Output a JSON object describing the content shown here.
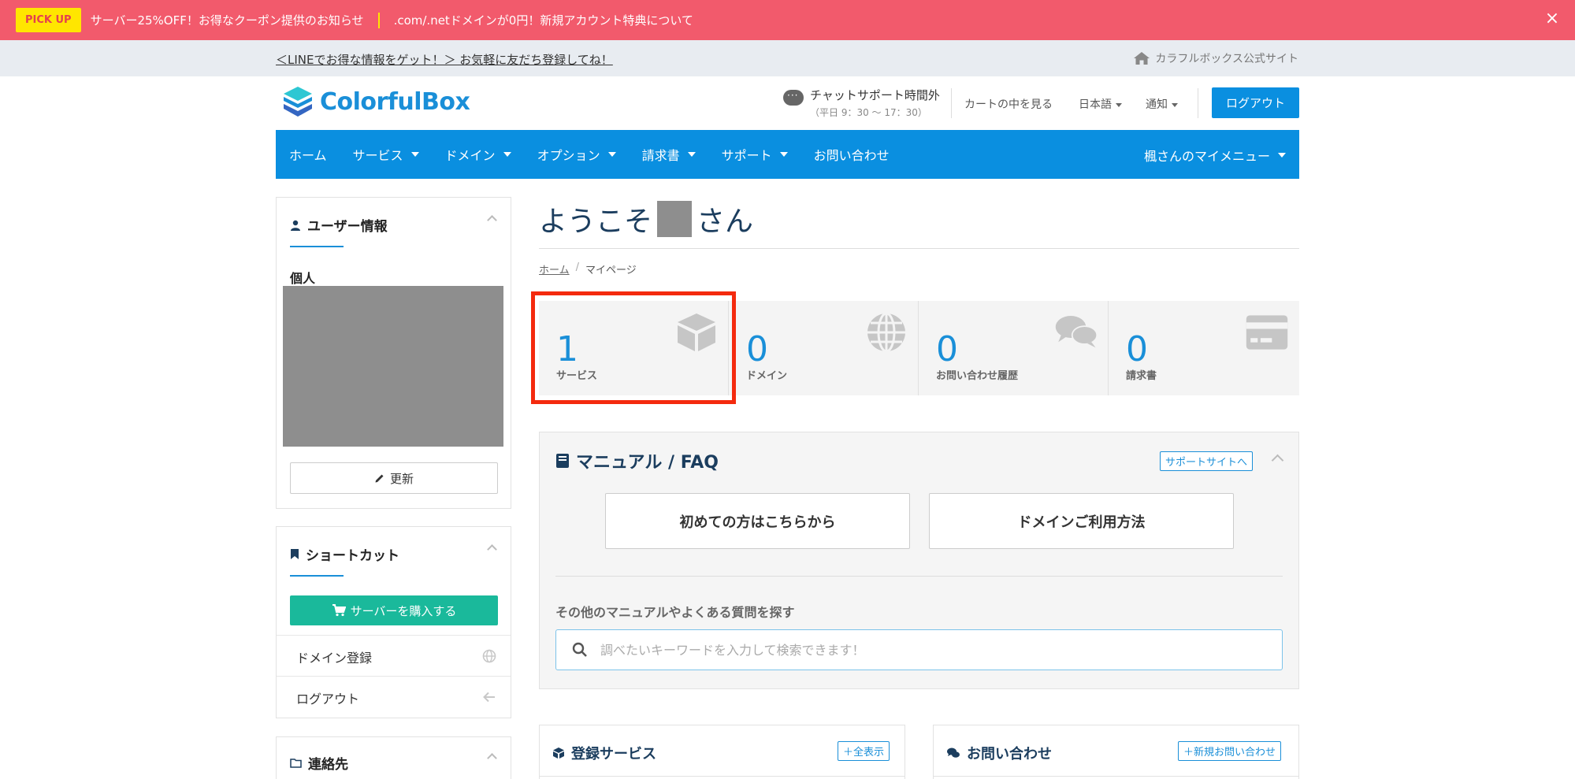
{
  "pickup": {
    "badge": "PICK UP",
    "notice1": "サーバー25%OFF！お得なクーポン提供のお知らせ",
    "notice2": ".com/.netドメインが0円！新規アカウント特典について",
    "close": "×"
  },
  "line_bar": {
    "line_text": "＜LINEでお得な情報をゲット！＞ お気軽に友だち登録してね！",
    "official_site": "カラフルボックス公式サイト"
  },
  "header": {
    "logo_text": "ColorfulBox",
    "chat_title": "チャットサポート時間外",
    "chat_hours": "（平日 9：30 〜 17：30）",
    "cart": "カートの中を見る",
    "language": "日本語",
    "notice": "通知",
    "logout": "ログアウト"
  },
  "nav": {
    "items": [
      {
        "label": "ホーム"
      },
      {
        "label": "サービス"
      },
      {
        "label": "ドメイン"
      },
      {
        "label": "オプション"
      },
      {
        "label": "請求書"
      },
      {
        "label": "サポート"
      },
      {
        "label": "お問い合わせ"
      }
    ],
    "my_menu": "楓さんのマイメニュー"
  },
  "sidebar": {
    "user_info_title": "ユーザー情報",
    "personal": "個人",
    "update": "更新",
    "shortcut_title": "ショートカット",
    "buy_server": "サーバーを購入する",
    "domain_register": "ドメイン登録",
    "logout": "ログアウト",
    "contact_title": "連絡先"
  },
  "main": {
    "welcome_prefix": "ようこそ",
    "welcome_suffix": "さん",
    "breadcrumb_home": "ホーム",
    "breadcrumb_sep": "/",
    "breadcrumb_current": "マイページ",
    "stats": [
      {
        "number": "1",
        "label": "サービス",
        "icon": "box-icon"
      },
      {
        "number": "0",
        "label": "ドメイン",
        "icon": "globe-icon"
      },
      {
        "number": "0",
        "label": "お問い合わせ履歴",
        "icon": "comments-icon"
      },
      {
        "number": "0",
        "label": "請求書",
        "icon": "credit-card-icon"
      }
    ],
    "faq": {
      "title": "マニュアル / FAQ",
      "support_site": "サポートサイトへ",
      "btn_first": "初めての方はこちらから",
      "btn_domain": "ドメインご利用方法",
      "search_label": "その他のマニュアルやよくある質問を探す",
      "search_placeholder": "調べたいキーワードを入力して検索できます！"
    },
    "services_panel": {
      "title": "登録サービス",
      "link": "全表示"
    },
    "contact_panel": {
      "title": "お問い合わせ",
      "link": "新規お問い合わせ"
    }
  },
  "colors": {
    "pickup_bg": "#f25a6c",
    "brand_blue": "#0a8fe0",
    "buy_green": "#1ab99b",
    "highlight_red": "#f42a0e"
  }
}
